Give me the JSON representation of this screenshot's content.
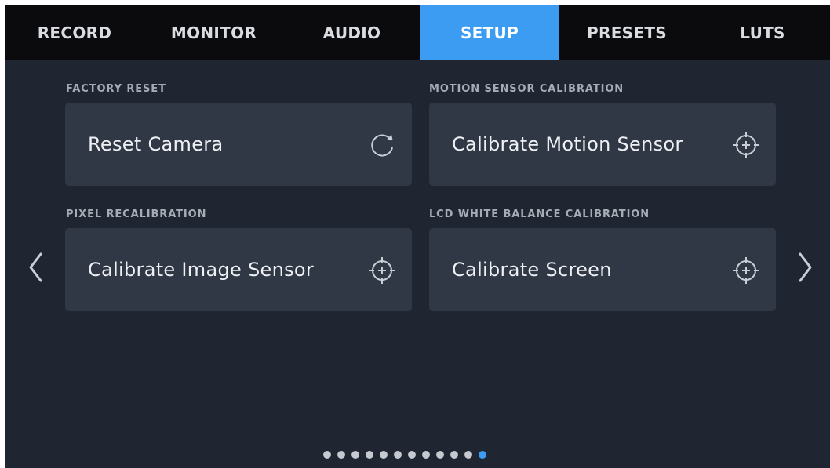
{
  "tabs": [
    {
      "label": "RECORD"
    },
    {
      "label": "MONITOR"
    },
    {
      "label": "AUDIO"
    },
    {
      "label": "SETUP",
      "active": true
    },
    {
      "label": "PRESETS"
    },
    {
      "label": "LUTS"
    }
  ],
  "sections": {
    "factory_reset": {
      "heading": "FACTORY RESET",
      "button": "Reset Camera",
      "icon": "refresh-icon"
    },
    "motion_sensor": {
      "heading": "MOTION SENSOR CALIBRATION",
      "button": "Calibrate Motion Sensor",
      "icon": "crosshair-icon"
    },
    "pixel_recalibration": {
      "heading": "PIXEL RECALIBRATION",
      "button": "Calibrate Image Sensor",
      "icon": "crosshair-icon"
    },
    "lcd_white_balance": {
      "heading": "LCD WHITE BALANCE CALIBRATION",
      "button": "Calibrate Screen",
      "icon": "crosshair-icon"
    }
  },
  "navigation": {
    "prev_icon": "chevron-left-icon",
    "next_icon": "chevron-right-icon"
  },
  "pager": {
    "total_pages": 12,
    "current_page": 12
  },
  "colors": {
    "accent": "#3b9cf2",
    "background": "#1f2631",
    "tab_bar": "#0b0b0d",
    "card": "#303846"
  }
}
